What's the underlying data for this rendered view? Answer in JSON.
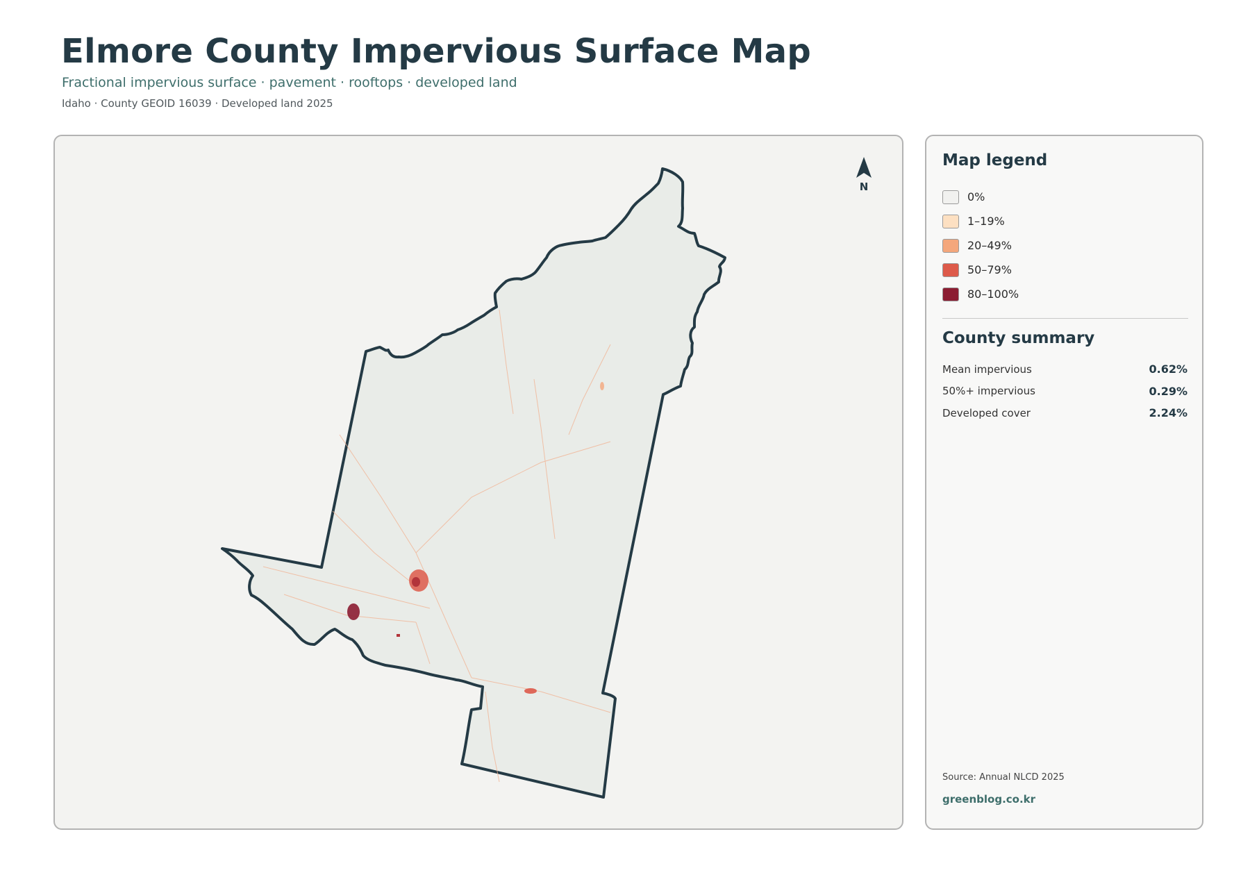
{
  "header": {
    "title": "Elmore County Impervious Surface Map",
    "subtitle": "Fractional impervious surface · pavement · rooftops · developed land",
    "meta": "Idaho · County GEOID 16039 · Developed land 2025"
  },
  "map": {
    "north_label": "N",
    "fill_color": "#e9ece8",
    "outline_color": "#243a45"
  },
  "legend": {
    "title": "Map legend",
    "items": [
      {
        "label": "0%",
        "color": "#f1f1ef"
      },
      {
        "label": "1–19%",
        "color": "#fde0c2"
      },
      {
        "label": "20–49%",
        "color": "#f4a77c"
      },
      {
        "label": "50–79%",
        "color": "#dd5a4a"
      },
      {
        "label": "80–100%",
        "color": "#8c1d32"
      }
    ]
  },
  "summary": {
    "title": "County summary",
    "rows": [
      {
        "label": "Mean impervious",
        "value": "0.62%"
      },
      {
        "label": "50%+ impervious",
        "value": "0.29%"
      },
      {
        "label": "Developed cover",
        "value": "2.24%"
      }
    ]
  },
  "footer": {
    "source": "Source: Annual NLCD 2025",
    "credit": "greenblog.co.kr"
  }
}
